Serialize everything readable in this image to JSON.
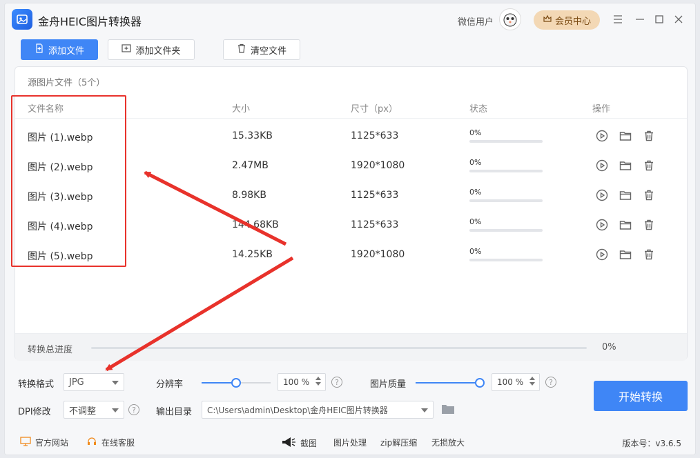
{
  "app": {
    "title": "金舟HEIC图片转换器"
  },
  "header": {
    "user_name": "微信用户",
    "vip_label": "会员中心"
  },
  "toolbar": {
    "add_file": "添加文件",
    "add_folder": "添加文件夹",
    "clear_files": "清空文件"
  },
  "panel": {
    "title": "源图片文件（5个）",
    "columns": [
      "文件名称",
      "大小",
      "尺寸（px）",
      "状态",
      "操作"
    ],
    "rows": [
      {
        "name": "图片 (1).webp",
        "size": "15.33KB",
        "dimensions": "1125*633",
        "status": "0%",
        "progress": 0
      },
      {
        "name": "图片 (2).webp",
        "size": "2.47MB",
        "dimensions": "1920*1080",
        "status": "0%",
        "progress": 0
      },
      {
        "name": "图片 (3).webp",
        "size": "8.98KB",
        "dimensions": "1125*633",
        "status": "0%",
        "progress": 0
      },
      {
        "name": "图片 (4).webp",
        "size": "144.68KB",
        "dimensions": "1125*633",
        "status": "0%",
        "progress": 0
      },
      {
        "name": "图片 (5).webp",
        "size": "14.25KB",
        "dimensions": "1920*1080",
        "status": "0%",
        "progress": 0
      }
    ],
    "total_label": "转换总进度",
    "total_percent": "0%",
    "total_progress": 0
  },
  "settings": {
    "format_label": "转换格式",
    "format_value": "JPG",
    "resolution_label": "分辨率",
    "resolution_value": "100 %",
    "resolution_level": 0.5,
    "quality_label": "图片质量",
    "quality_value": "100 %",
    "quality_level": 1.0,
    "dpi_label": "DPI修改",
    "dpi_value": "不调整",
    "output_label": "输出目录",
    "output_value": "C:\\Users\\admin\\Desktop\\金舟HEIC图片转换器",
    "start_button": "开始转换"
  },
  "footer": {
    "website": "官方网站",
    "support": "在线客服",
    "screenshot": "截图",
    "image_processing": "图片处理",
    "zip": "zip解压缩",
    "lossless": "无损放大",
    "version": "版本号：v3.6.5"
  },
  "colors": {
    "accent": "#3f86f6",
    "annotation": "#e8322b",
    "vip_bg": "#f3d8b5"
  }
}
